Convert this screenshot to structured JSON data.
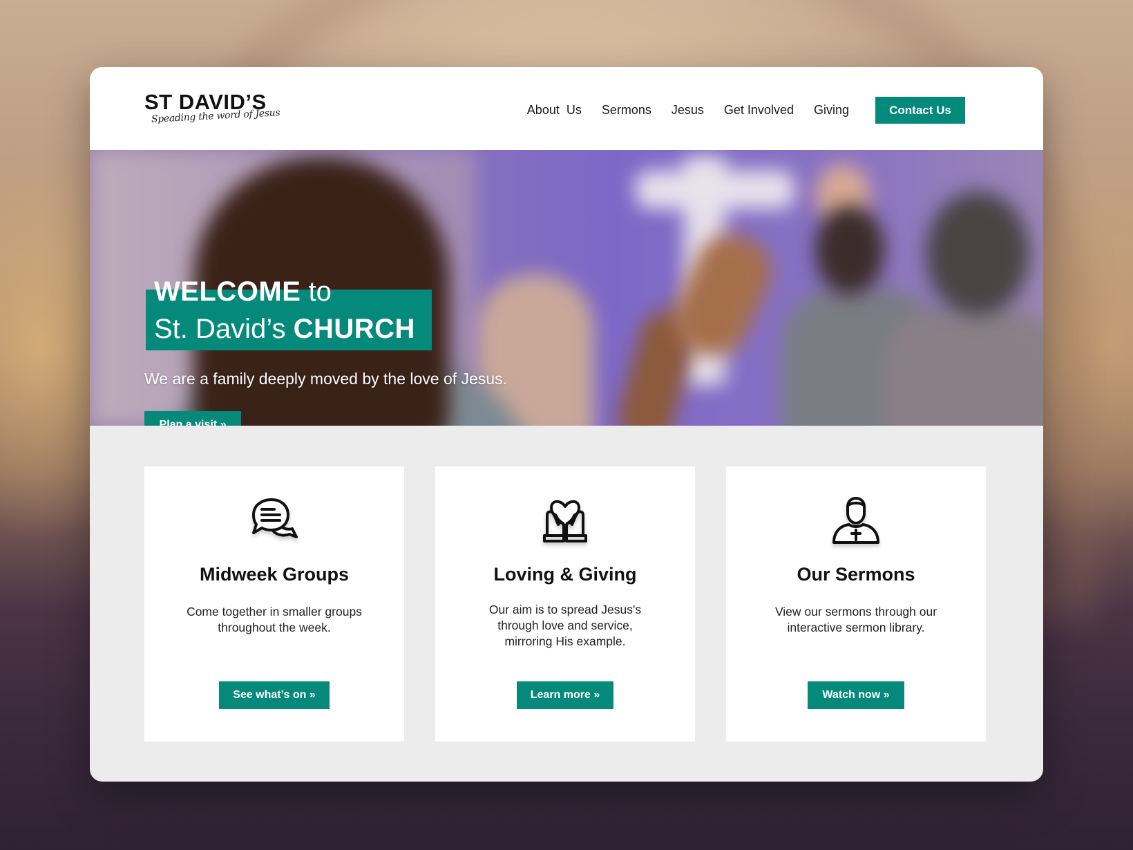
{
  "site": {
    "logo_title": "ST DAVID’S",
    "logo_tagline": "Speading the word of Jesus"
  },
  "nav": {
    "items": [
      {
        "label": "About  Us"
      },
      {
        "label": "Sermons"
      },
      {
        "label": "Jesus"
      },
      {
        "label": "Get Involved"
      },
      {
        "label": "Giving"
      }
    ],
    "contact_label": "Contact Us"
  },
  "hero": {
    "title_bold_1": "WELCOME",
    "title_light_1": " to",
    "title_light_2": "St. David’s ",
    "title_bold_2": "CHURCH",
    "subtitle": "We are a family deeply moved by the love of Jesus.",
    "cta_label": "Plan a visit »"
  },
  "features": [
    {
      "icon": "chat-bubbles-icon",
      "title": "Midweek Groups",
      "text": "Come together in smaller groups throughout the week.",
      "button_label": "See what’s on »"
    },
    {
      "icon": "hands-heart-icon",
      "title": "Loving & Giving",
      "text": "Our aim is to spread Jesus's through love and service, mirroring His example.",
      "button_label": "Learn more »"
    },
    {
      "icon": "priest-icon",
      "title": "Our Sermons",
      "text": "View our sermons through our interactive sermon library.",
      "button_label": "Watch now »"
    }
  ],
  "colors": {
    "accent": "#05897a",
    "section_bg": "#ececec"
  }
}
